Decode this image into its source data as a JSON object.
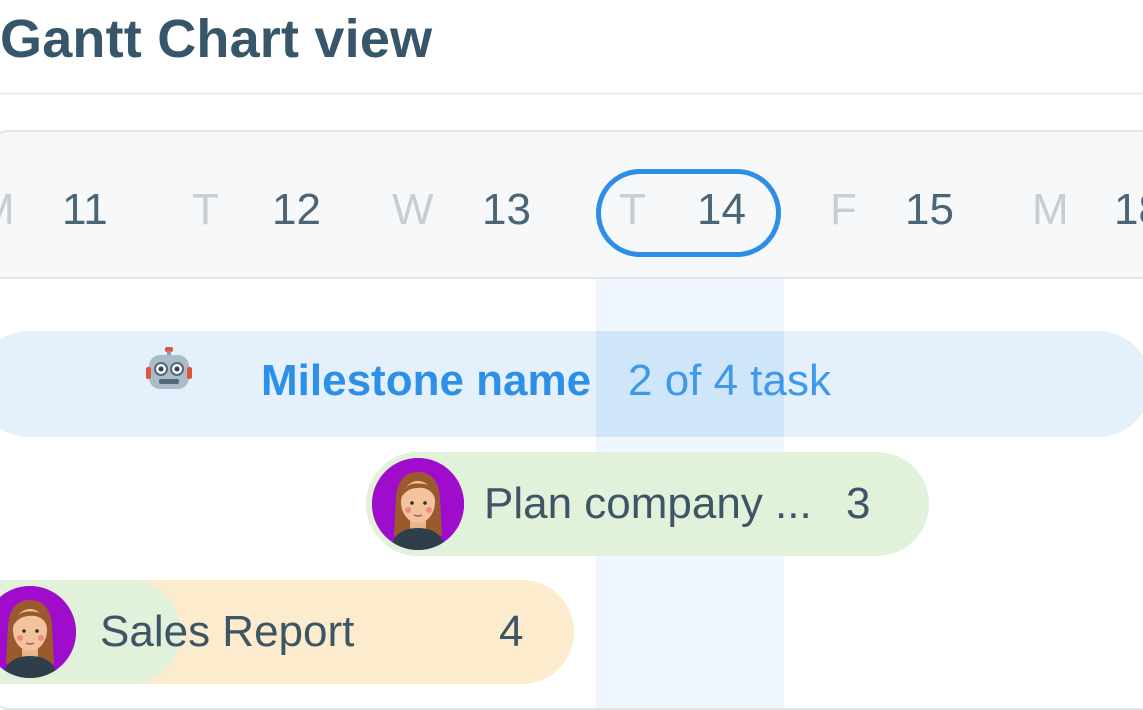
{
  "page": {
    "title": "Gantt Chart view"
  },
  "timeline": {
    "days": [
      {
        "letter": "M",
        "number": "11"
      },
      {
        "letter": "T",
        "number": "12"
      },
      {
        "letter": "W",
        "number": "13"
      },
      {
        "letter": "T",
        "number": "14"
      },
      {
        "letter": "F",
        "number": "15"
      },
      {
        "letter": "M",
        "number": "18"
      }
    ],
    "today_index": 3
  },
  "milestone": {
    "icon": "robot-icon",
    "name": "Milestone name",
    "progress_text": "2 of 4 task"
  },
  "tasks": [
    {
      "name": "Plan company ...",
      "count": "3",
      "assignee_avatar": "avatar-woman",
      "bar_color": "#e2f1d9"
    },
    {
      "name": "Sales Report",
      "count": "4",
      "assignee_avatar": "avatar-woman",
      "bar_color": "#fcebcc",
      "progress_color": "#e2f1d9"
    }
  ],
  "colors": {
    "accent": "#2c8ee6",
    "title": "#37566a",
    "milestone_bg": "#e4f1fc"
  }
}
